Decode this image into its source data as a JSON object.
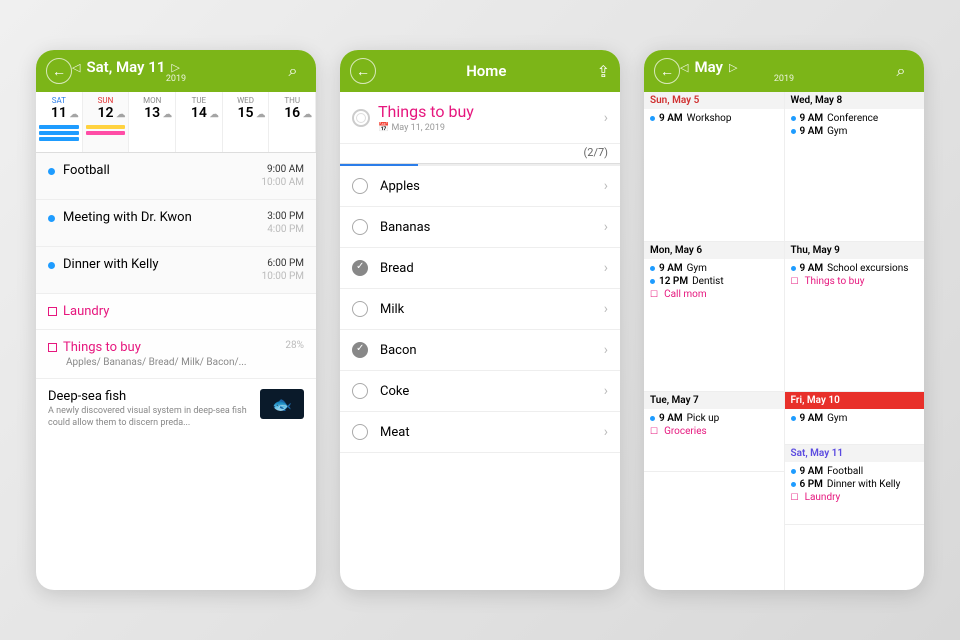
{
  "s1": {
    "title": "Sat, May 11",
    "year": "2019",
    "days": [
      {
        "dow": "SAT",
        "num": "11",
        "cls": "sat",
        "bars": [
          "#1e9cff",
          "#1e9cff",
          "#1e9cff"
        ]
      },
      {
        "dow": "SUN",
        "num": "12",
        "cls": "sun",
        "bars": [
          "#ffd23f",
          "#ff4da6"
        ]
      },
      {
        "dow": "MON",
        "num": "13",
        "cls": "",
        "bars": []
      },
      {
        "dow": "TUE",
        "num": "14",
        "cls": "",
        "bars": []
      },
      {
        "dow": "WED",
        "num": "15",
        "cls": "",
        "bars": []
      },
      {
        "dow": "THU",
        "num": "16",
        "cls": "",
        "bars": []
      }
    ],
    "events": [
      {
        "title": "Football",
        "start": "9:00 AM",
        "end": "10:00 AM"
      },
      {
        "title": "Meeting with Dr. Kwon",
        "start": "3:00 PM",
        "end": "4:00 PM"
      },
      {
        "title": "Dinner with Kelly",
        "start": "6:00 PM",
        "end": "10:00 PM"
      }
    ],
    "tasks": [
      {
        "title": "Laundry",
        "sub": "",
        "pct": ""
      },
      {
        "title": "Things to buy",
        "sub": "Apples/ Bananas/ Bread/ Milk/ Bacon/...",
        "pct": "28%"
      }
    ],
    "news": {
      "h": "Deep-sea fish",
      "d": "A newly discovered visual system in deep-sea fish could allow them to discern preda..."
    }
  },
  "s2": {
    "title": "Home",
    "listTitle": "Things to buy",
    "listDate": "May 11, 2019",
    "progress": "(2/7)",
    "items": [
      {
        "name": "Apples",
        "done": false
      },
      {
        "name": "Bananas",
        "done": false
      },
      {
        "name": "Bread",
        "done": true
      },
      {
        "name": "Milk",
        "done": false
      },
      {
        "name": "Bacon",
        "done": true
      },
      {
        "name": "Coke",
        "done": false
      },
      {
        "name": "Meat",
        "done": false
      }
    ]
  },
  "s3": {
    "title": "May",
    "year": "2019",
    "left": [
      {
        "h": "Sun, May 5",
        "cls": "sun tall",
        "rows": [
          {
            "t": "event",
            "time": "9 AM",
            "txt": "Workshop"
          }
        ]
      },
      {
        "h": "Mon, May 6",
        "cls": "tall",
        "rows": [
          {
            "t": "event",
            "time": "9 AM",
            "txt": "Gym"
          },
          {
            "t": "event",
            "time": "12 PM",
            "txt": "Dentist"
          },
          {
            "t": "task",
            "txt": "Call mom"
          }
        ]
      },
      {
        "h": "Tue, May 7",
        "cls": "",
        "rows": [
          {
            "t": "event",
            "time": "9 AM",
            "txt": "Pick up"
          },
          {
            "t": "task",
            "txt": "Groceries"
          }
        ]
      }
    ],
    "right": [
      {
        "h": "Wed, May 8",
        "cls": "tall",
        "rows": [
          {
            "t": "event",
            "time": "9 AM",
            "txt": "Conference"
          },
          {
            "t": "event",
            "time": "9 AM",
            "txt": "Gym"
          }
        ]
      },
      {
        "h": "Thu, May 9",
        "cls": "tall",
        "rows": [
          {
            "t": "event",
            "time": "9 AM",
            "txt": "School excursions"
          },
          {
            "t": "task",
            "txt": "Things to buy"
          }
        ]
      },
      {
        "h": "Fri, May 10",
        "cls": "fri short",
        "rows": [
          {
            "t": "event",
            "time": "9 AM",
            "txt": "Gym"
          }
        ]
      },
      {
        "h": "Sat, May 11",
        "cls": "sat",
        "rows": [
          {
            "t": "event",
            "time": "9 AM",
            "txt": "Football"
          },
          {
            "t": "event",
            "time": "6 PM",
            "txt": "Dinner with Kelly"
          },
          {
            "t": "task",
            "txt": "Laundry"
          }
        ]
      }
    ]
  }
}
